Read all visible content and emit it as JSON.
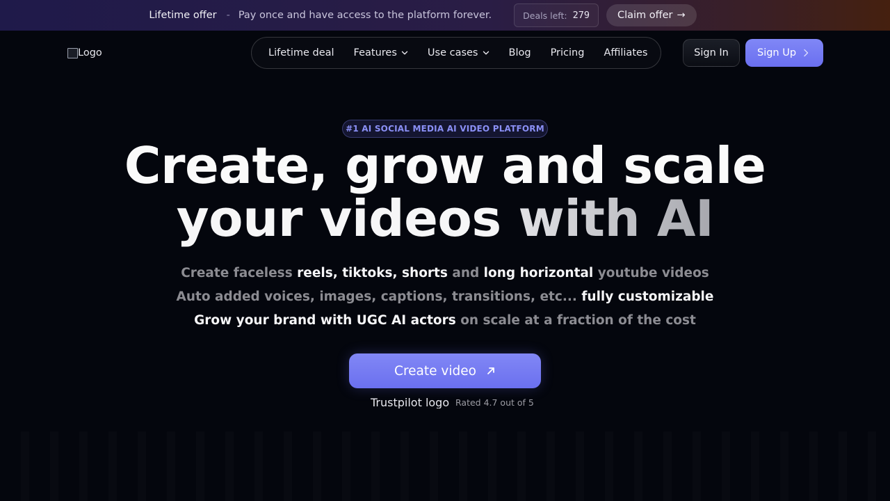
{
  "announcement": {
    "title": "Lifetime offer",
    "separator": "-",
    "description": "Pay once and have access to the platform forever.",
    "deals_label": "Deals left:",
    "deals_count": "279",
    "claim_label": "Claim offer",
    "claim_arrow": "→"
  },
  "header": {
    "logo_alt": "Logo",
    "nav": [
      {
        "label": "Lifetime deal",
        "dropdown": false
      },
      {
        "label": "Features",
        "dropdown": true
      },
      {
        "label": "Use cases",
        "dropdown": true
      },
      {
        "label": "Blog",
        "dropdown": false
      },
      {
        "label": "Pricing",
        "dropdown": false
      },
      {
        "label": "Affiliates",
        "dropdown": false
      }
    ],
    "signin_label": "Sign In",
    "signup_label": "Sign Up"
  },
  "hero": {
    "badge": "#1 AI SOCIAL MEDIA AI VIDEO PLATFORM",
    "title_line1": "Create, grow and scale",
    "title_line2a": "your videos ",
    "title_line2b": "with AI",
    "line1": {
      "a": "Create faceless ",
      "b": "reels, tiktoks, shorts",
      "c": " and ",
      "d": "long horizontal",
      "e": " youtube videos"
    },
    "line2": {
      "a": "Auto added voices, images, captions, transitions, etc... ",
      "b": "fully customizable"
    },
    "line3": {
      "a": "Grow your brand with UGC AI actors",
      "b": " on scale at a fraction of the cost"
    },
    "cta_label": "Create video",
    "trustpilot_alt": "Trustpilot logo",
    "rating_text": "Rated 4.7 out of 5"
  },
  "colors": {
    "background": "#04060d",
    "accent": "#7279f2",
    "badge_text": "#8a8ff5",
    "muted_text": "#8c8c92"
  }
}
